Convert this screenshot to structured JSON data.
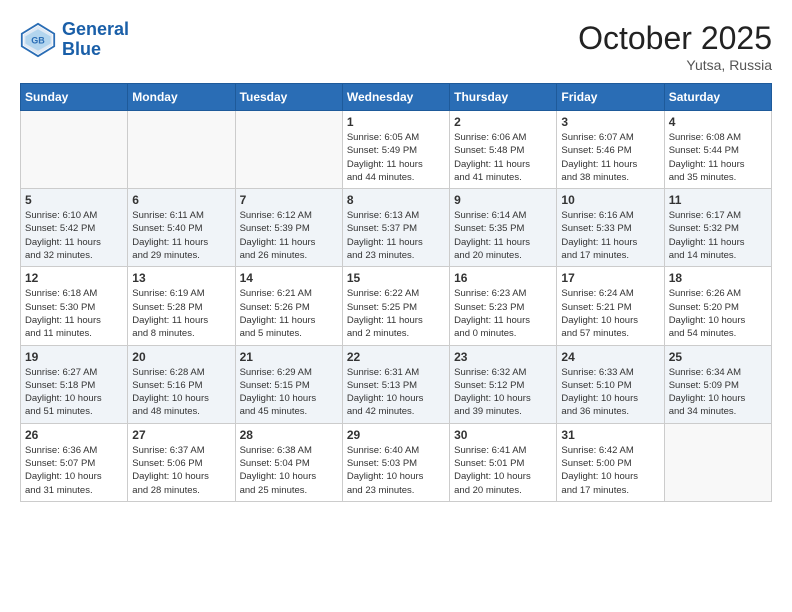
{
  "header": {
    "logo_line1": "General",
    "logo_line2": "Blue",
    "month_year": "October 2025",
    "location": "Yutsa, Russia"
  },
  "weekdays": [
    "Sunday",
    "Monday",
    "Tuesday",
    "Wednesday",
    "Thursday",
    "Friday",
    "Saturday"
  ],
  "weeks": [
    [
      {
        "day": "",
        "info": ""
      },
      {
        "day": "",
        "info": ""
      },
      {
        "day": "",
        "info": ""
      },
      {
        "day": "1",
        "info": "Sunrise: 6:05 AM\nSunset: 5:49 PM\nDaylight: 11 hours\nand 44 minutes."
      },
      {
        "day": "2",
        "info": "Sunrise: 6:06 AM\nSunset: 5:48 PM\nDaylight: 11 hours\nand 41 minutes."
      },
      {
        "day": "3",
        "info": "Sunrise: 6:07 AM\nSunset: 5:46 PM\nDaylight: 11 hours\nand 38 minutes."
      },
      {
        "day": "4",
        "info": "Sunrise: 6:08 AM\nSunset: 5:44 PM\nDaylight: 11 hours\nand 35 minutes."
      }
    ],
    [
      {
        "day": "5",
        "info": "Sunrise: 6:10 AM\nSunset: 5:42 PM\nDaylight: 11 hours\nand 32 minutes."
      },
      {
        "day": "6",
        "info": "Sunrise: 6:11 AM\nSunset: 5:40 PM\nDaylight: 11 hours\nand 29 minutes."
      },
      {
        "day": "7",
        "info": "Sunrise: 6:12 AM\nSunset: 5:39 PM\nDaylight: 11 hours\nand 26 minutes."
      },
      {
        "day": "8",
        "info": "Sunrise: 6:13 AM\nSunset: 5:37 PM\nDaylight: 11 hours\nand 23 minutes."
      },
      {
        "day": "9",
        "info": "Sunrise: 6:14 AM\nSunset: 5:35 PM\nDaylight: 11 hours\nand 20 minutes."
      },
      {
        "day": "10",
        "info": "Sunrise: 6:16 AM\nSunset: 5:33 PM\nDaylight: 11 hours\nand 17 minutes."
      },
      {
        "day": "11",
        "info": "Sunrise: 6:17 AM\nSunset: 5:32 PM\nDaylight: 11 hours\nand 14 minutes."
      }
    ],
    [
      {
        "day": "12",
        "info": "Sunrise: 6:18 AM\nSunset: 5:30 PM\nDaylight: 11 hours\nand 11 minutes."
      },
      {
        "day": "13",
        "info": "Sunrise: 6:19 AM\nSunset: 5:28 PM\nDaylight: 11 hours\nand 8 minutes."
      },
      {
        "day": "14",
        "info": "Sunrise: 6:21 AM\nSunset: 5:26 PM\nDaylight: 11 hours\nand 5 minutes."
      },
      {
        "day": "15",
        "info": "Sunrise: 6:22 AM\nSunset: 5:25 PM\nDaylight: 11 hours\nand 2 minutes."
      },
      {
        "day": "16",
        "info": "Sunrise: 6:23 AM\nSunset: 5:23 PM\nDaylight: 11 hours\nand 0 minutes."
      },
      {
        "day": "17",
        "info": "Sunrise: 6:24 AM\nSunset: 5:21 PM\nDaylight: 10 hours\nand 57 minutes."
      },
      {
        "day": "18",
        "info": "Sunrise: 6:26 AM\nSunset: 5:20 PM\nDaylight: 10 hours\nand 54 minutes."
      }
    ],
    [
      {
        "day": "19",
        "info": "Sunrise: 6:27 AM\nSunset: 5:18 PM\nDaylight: 10 hours\nand 51 minutes."
      },
      {
        "day": "20",
        "info": "Sunrise: 6:28 AM\nSunset: 5:16 PM\nDaylight: 10 hours\nand 48 minutes."
      },
      {
        "day": "21",
        "info": "Sunrise: 6:29 AM\nSunset: 5:15 PM\nDaylight: 10 hours\nand 45 minutes."
      },
      {
        "day": "22",
        "info": "Sunrise: 6:31 AM\nSunset: 5:13 PM\nDaylight: 10 hours\nand 42 minutes."
      },
      {
        "day": "23",
        "info": "Sunrise: 6:32 AM\nSunset: 5:12 PM\nDaylight: 10 hours\nand 39 minutes."
      },
      {
        "day": "24",
        "info": "Sunrise: 6:33 AM\nSunset: 5:10 PM\nDaylight: 10 hours\nand 36 minutes."
      },
      {
        "day": "25",
        "info": "Sunrise: 6:34 AM\nSunset: 5:09 PM\nDaylight: 10 hours\nand 34 minutes."
      }
    ],
    [
      {
        "day": "26",
        "info": "Sunrise: 6:36 AM\nSunset: 5:07 PM\nDaylight: 10 hours\nand 31 minutes."
      },
      {
        "day": "27",
        "info": "Sunrise: 6:37 AM\nSunset: 5:06 PM\nDaylight: 10 hours\nand 28 minutes."
      },
      {
        "day": "28",
        "info": "Sunrise: 6:38 AM\nSunset: 5:04 PM\nDaylight: 10 hours\nand 25 minutes."
      },
      {
        "day": "29",
        "info": "Sunrise: 6:40 AM\nSunset: 5:03 PM\nDaylight: 10 hours\nand 23 minutes."
      },
      {
        "day": "30",
        "info": "Sunrise: 6:41 AM\nSunset: 5:01 PM\nDaylight: 10 hours\nand 20 minutes."
      },
      {
        "day": "31",
        "info": "Sunrise: 6:42 AM\nSunset: 5:00 PM\nDaylight: 10 hours\nand 17 minutes."
      },
      {
        "day": "",
        "info": ""
      }
    ]
  ]
}
